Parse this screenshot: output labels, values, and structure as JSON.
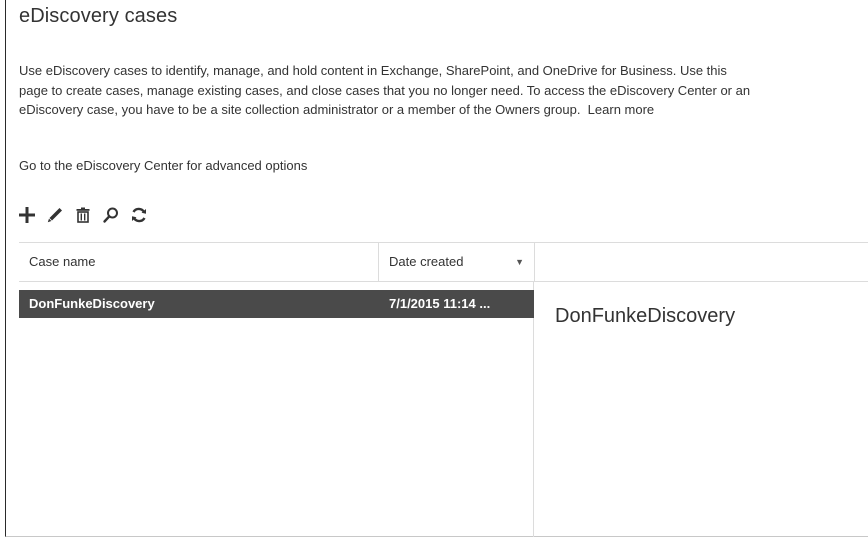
{
  "page": {
    "title": "eDiscovery cases",
    "description_lines": [
      "Use eDiscovery cases to identify, manage, and hold content in Exchange, SharePoint, and OneDrive for Business. Use this",
      "page to create cases, manage existing cases, and close cases that you no longer need. To access the eDiscovery Center or an",
      "eDiscovery case, you have to be a site collection administrator or a member of the Owners group."
    ],
    "learn_more": "Learn more",
    "center_link": "Go to the eDiscovery Center for advanced options"
  },
  "toolbar": {
    "icons": [
      "add-icon",
      "edit-icon",
      "delete-icon",
      "search-icon",
      "refresh-icon"
    ]
  },
  "table": {
    "columns": [
      "Case name",
      "Date created"
    ],
    "sort_indicator": "▼",
    "rows": [
      {
        "case_name": "DonFunkeDiscovery",
        "date_created": "7/1/2015 11:14 ...",
        "selected": true
      }
    ]
  },
  "details": {
    "title": "DonFunkeDiscovery"
  },
  "colors": {
    "selected_row_bg": "#4a4a4a",
    "text": "#333333",
    "border": "#dcdcdc"
  }
}
